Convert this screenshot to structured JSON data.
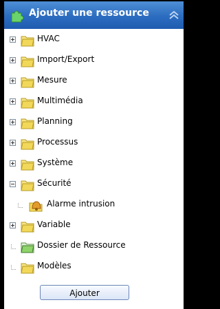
{
  "header": {
    "title": "Ajouter une ressource"
  },
  "tree": [
    {
      "label": "HVAC",
      "state": "collapsed",
      "icon": "folder-icon"
    },
    {
      "label": "Import/Export",
      "state": "collapsed",
      "icon": "folder-icon"
    },
    {
      "label": "Mesure",
      "state": "collapsed",
      "icon": "folder-icon"
    },
    {
      "label": "Multimédia",
      "state": "collapsed",
      "icon": "folder-icon"
    },
    {
      "label": "Planning",
      "state": "collapsed",
      "icon": "folder-icon"
    },
    {
      "label": "Processus",
      "state": "collapsed",
      "icon": "folder-icon"
    },
    {
      "label": "Système",
      "state": "collapsed",
      "icon": "folder-icon"
    },
    {
      "label": "Sécurité",
      "state": "expanded",
      "icon": "folder-icon",
      "children": [
        {
          "label": "Alarme intrusion",
          "icon": "alarm-bell-icon"
        }
      ]
    },
    {
      "label": "Variable",
      "state": "collapsed",
      "icon": "folder-icon"
    },
    {
      "label": "Dossier de Ressource",
      "state": "leaf",
      "icon": "resource-folder-icon"
    },
    {
      "label": "Modèles",
      "state": "leaf",
      "icon": "folder-icon"
    }
  ],
  "actions": {
    "add_label": "Ajouter"
  },
  "colors": {
    "header": "#2c6cc0",
    "folder": "#f2d85a"
  }
}
